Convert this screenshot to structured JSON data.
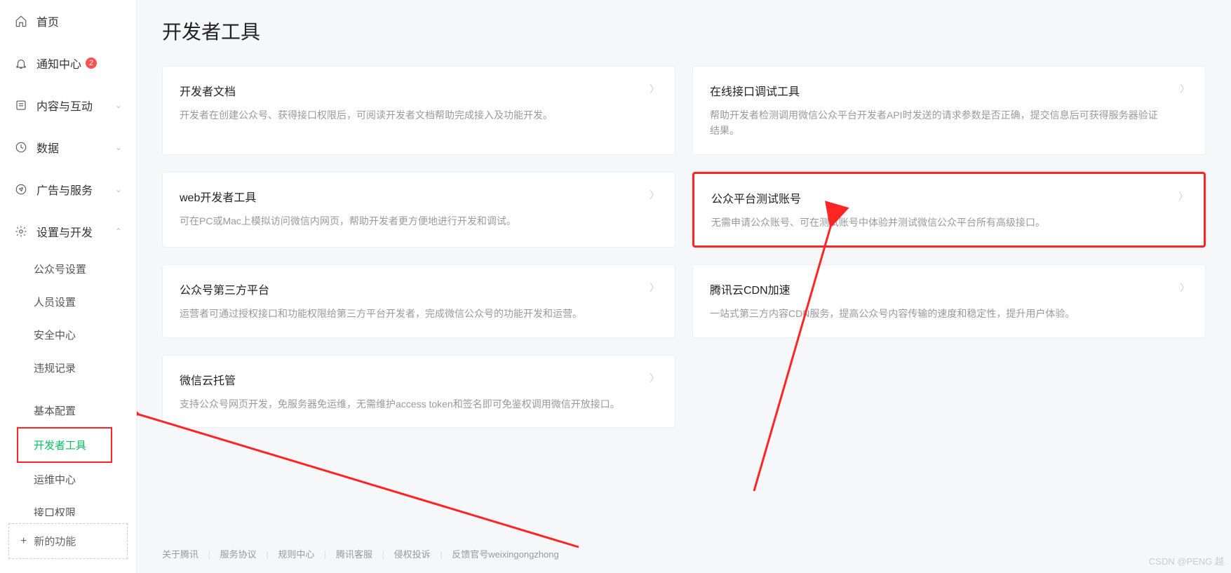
{
  "sidebar": {
    "home": "首页",
    "notify": "通知中心",
    "notify_badge": "2",
    "content": "内容与互动",
    "data": "数据",
    "ads": "广告与服务",
    "settings": "设置与开发",
    "sub": {
      "account": "公众号设置",
      "staff": "人员设置",
      "security": "安全中心",
      "violation": "违规记录",
      "basic": "基本配置",
      "devtools": "开发者工具",
      "ops": "运维中心",
      "perm": "接口权限"
    },
    "new_feature": "新的功能"
  },
  "page": {
    "title": "开发者工具"
  },
  "cards": {
    "docs": {
      "title": "开发者文档",
      "desc": "开发者在创建公众号、获得接口权限后，可阅读开发者文档帮助完成接入及功能开发。"
    },
    "debug": {
      "title": "在线接口调试工具",
      "desc": "帮助开发者检测调用微信公众平台开发者API时发送的请求参数是否正确，提交信息后可获得服务器验证结果。"
    },
    "web": {
      "title": "web开发者工具",
      "desc": "可在PC或Mac上模拟访问微信内网页，帮助开发者更方便地进行开发和调试。"
    },
    "test": {
      "title": "公众平台测试账号",
      "desc": "无需申请公众账号、可在测试账号中体验并测试微信公众平台所有高级接口。"
    },
    "thirdparty": {
      "title": "公众号第三方平台",
      "desc": "运营者可通过授权接口和功能权限给第三方平台开发者，完成微信公众号的功能开发和运营。"
    },
    "cdn": {
      "title": "腾讯云CDN加速",
      "desc": "一站式第三方内容CDN服务，提高公众号内容传输的速度和稳定性，提升用户体验。"
    },
    "cloud": {
      "title": "微信云托管",
      "desc": "支持公众号网页开发，免服务器免运维，无需维护access token和签名即可免鉴权调用微信开放接口。"
    }
  },
  "footer": {
    "about": "关于腾讯",
    "tos": "服务协议",
    "rules": "规则中心",
    "support": "腾讯客服",
    "infringe": "侵权投诉",
    "feedback": "反馈官号weixingongzhong"
  },
  "watermark": "CSDN @PENG 越"
}
